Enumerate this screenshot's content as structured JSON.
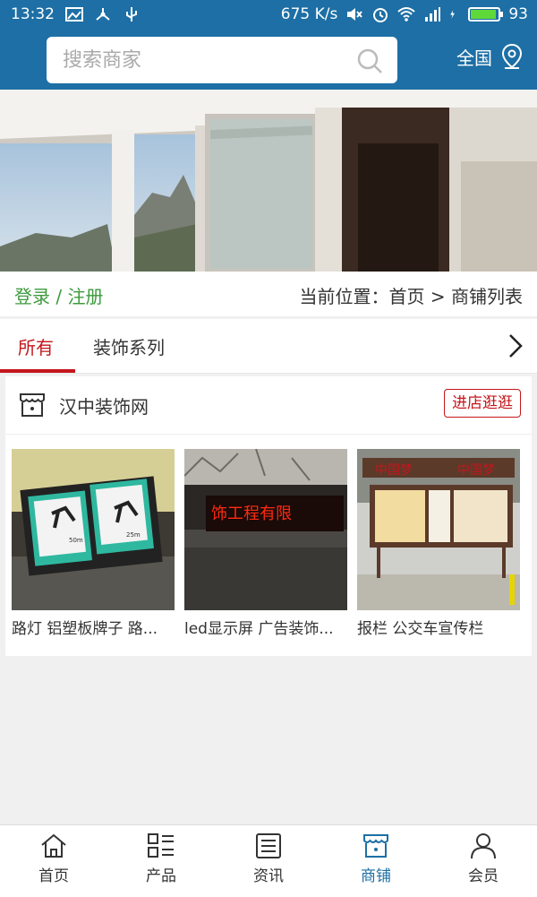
{
  "status_bar": {
    "time": "13:32",
    "net_speed": "675 K/s",
    "battery": "93",
    "battery_level": 0.93
  },
  "header": {
    "search_placeholder": "搜索商家",
    "region": "全国"
  },
  "breadcrumb": {
    "login": "登录",
    "separator": "/",
    "register": "注册",
    "location": "当前位置：首页 > 商铺列表"
  },
  "tabs": [
    {
      "label": "所有",
      "active": true
    },
    {
      "label": "装饰系列",
      "active": false
    }
  ],
  "shop": {
    "name": "汉中装饰网",
    "enter_label": "进店逛逛",
    "products": [
      {
        "name": "路灯 铝塑板牌子 路...",
        "image_text": [
          "50m",
          "25m"
        ]
      },
      {
        "name": "led显示屏 广告装饰...",
        "image_text": [
          "饰工程有限"
        ]
      },
      {
        "name": "报栏 公交车宣传栏",
        "image_text": [
          "中国梦",
          "中国梦"
        ]
      }
    ]
  },
  "bottom_nav": [
    {
      "label": "首页",
      "icon": "home-icon",
      "active": false
    },
    {
      "label": "产品",
      "icon": "grid-list-icon",
      "active": false
    },
    {
      "label": "资讯",
      "icon": "news-icon",
      "active": false
    },
    {
      "label": "商铺",
      "icon": "store-icon",
      "active": true
    },
    {
      "label": "会员",
      "icon": "user-icon",
      "active": false
    }
  ],
  "colors": {
    "brand_blue": "#1d6fa5",
    "accent_red": "#c4161c",
    "link_green": "#3d9a3d"
  }
}
